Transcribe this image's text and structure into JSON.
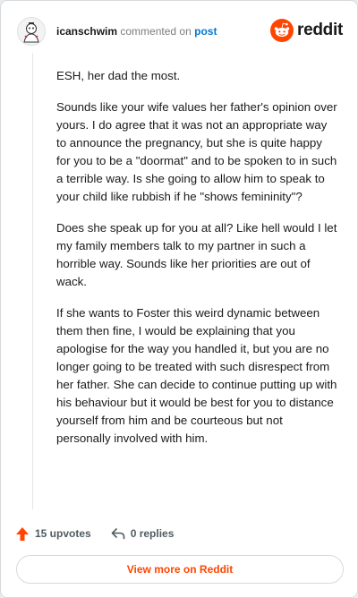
{
  "header": {
    "username": "icanschwim",
    "action_text": "commented on",
    "post_link": "post",
    "brand": "reddit"
  },
  "comment": {
    "paragraphs": [
      "ESH, her dad the most.",
      "Sounds like your wife values her father's opinion over yours. I do agree that it was not an appropriate way to announce the pregnancy, but she is quite happy for you to be a \"doormat\" and to be spoken to in such a terrible way. Is she going to allow him to speak to your child like rubbish if he \"shows femininity\"?",
      "Does she speak up for you at all? Like hell would I let my family members talk to my partner in such a horrible way. Sounds like her priorities are out of wack.",
      "If she wants to Foster this weird dynamic between them then fine, I would be explaining that you apologise for the way you handled it, but you are no longer going to be treated with such disrespect from her father. She can decide to continue putting up with his behaviour but it would be best for you to distance yourself from him and be courteous but not personally involved with him."
    ]
  },
  "footer": {
    "upvotes_label": "15 upvotes",
    "replies_label": "0 replies",
    "view_more_label": "View more on Reddit"
  },
  "colors": {
    "accent": "#ff4500",
    "link": "#0079d3",
    "text": "#1a1a1b",
    "muted": "#7c7c7c"
  },
  "icons": {
    "avatar": "user-avatar",
    "brand": "reddit-logo-icon",
    "upvote": "upvote-arrow-icon",
    "reply": "reply-arrow-icon"
  }
}
